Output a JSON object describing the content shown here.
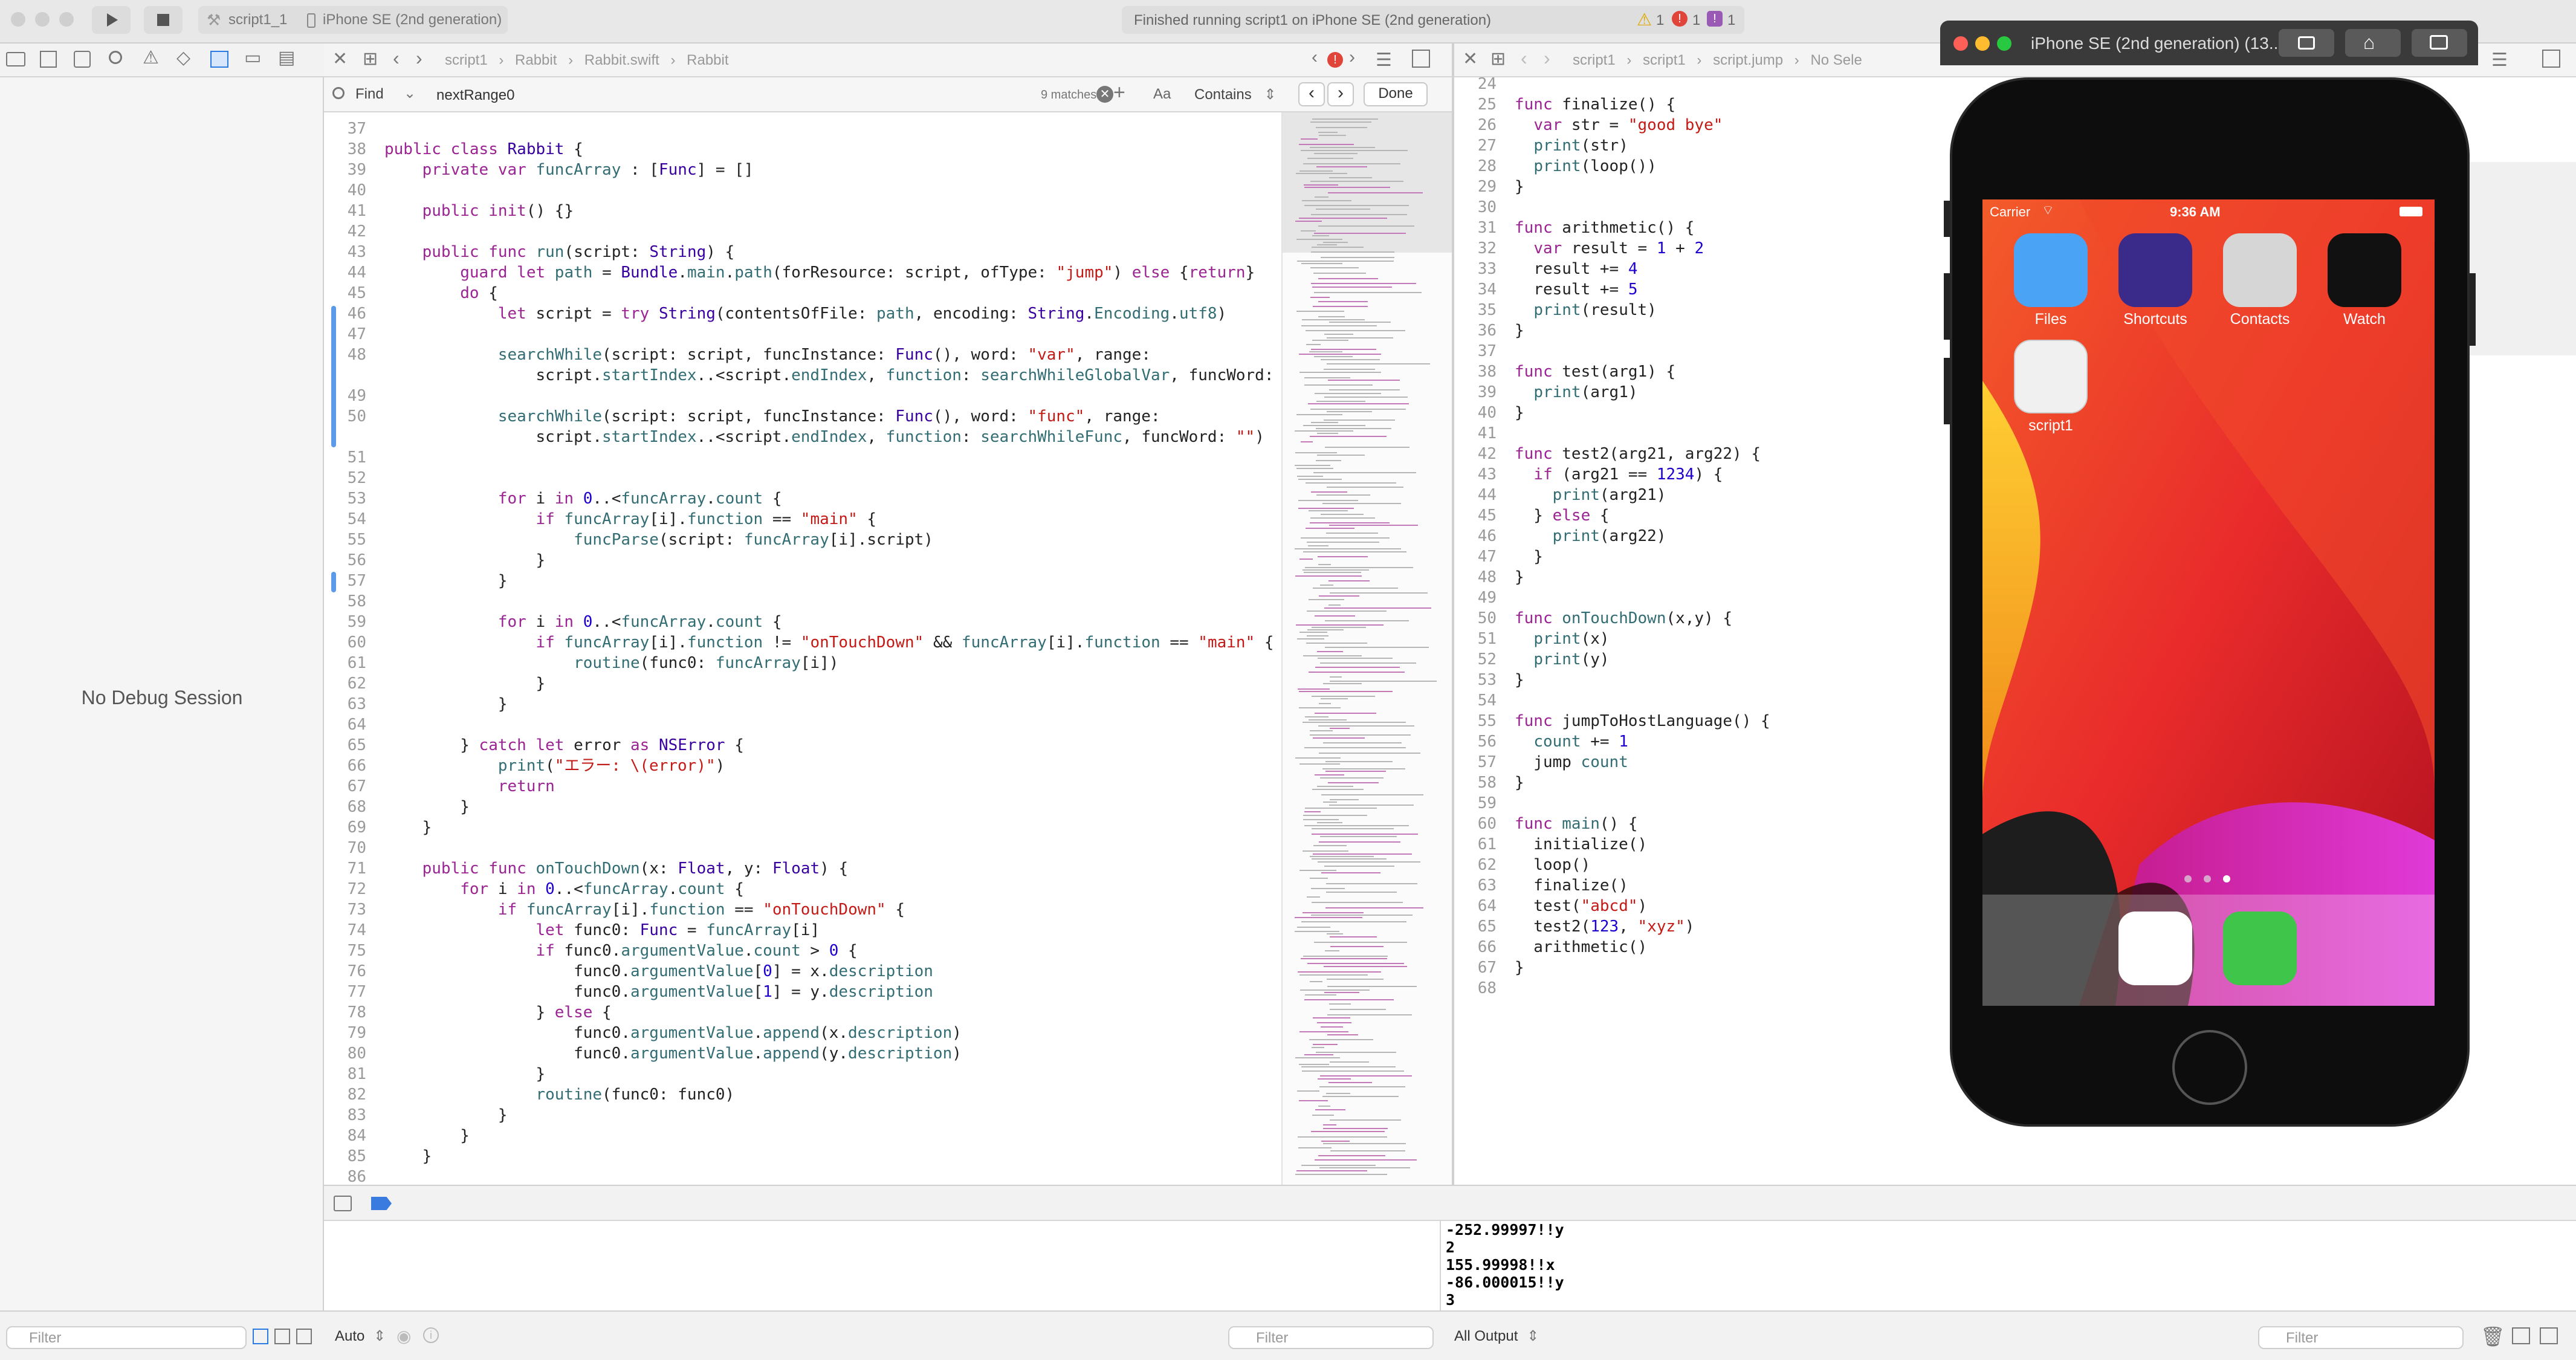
{
  "toolbar": {
    "scheme": "script1_1",
    "device": "iPhone SE (2nd generation)",
    "status": "Finished running script1 on iPhone SE (2nd generation)",
    "warnings": "1",
    "errors": "1",
    "issues": "1"
  },
  "navigator": {
    "no_debug": "No Debug Session",
    "filter_placeholder": "Filter"
  },
  "editor1": {
    "breadcrumbs": [
      "script1",
      "Rabbit",
      "Rabbit.swift",
      "Rabbit"
    ],
    "find_mode": "Find",
    "find_query": "nextRange0",
    "matches": "9 matches",
    "case_label": "Aa",
    "contains_label": "Contains",
    "done_label": "Done",
    "lines": [
      {
        "n": "37",
        "t": ""
      },
      {
        "n": "38",
        "t": "public class Rabbit {"
      },
      {
        "n": "39",
        "t": "    private var funcArray : [Func] = []"
      },
      {
        "n": "40",
        "t": ""
      },
      {
        "n": "41",
        "t": "    public init() {}"
      },
      {
        "n": "42",
        "t": ""
      },
      {
        "n": "43",
        "t": "    public func run(script: String) {"
      },
      {
        "n": "44",
        "t": "        guard let path = Bundle.main.path(forResource: script, ofType: \"jump\") else {return}"
      },
      {
        "n": "45",
        "t": "        do {"
      },
      {
        "n": "46",
        "t": "            let script = try String(contentsOfFile: path, encoding: String.Encoding.utf8)"
      },
      {
        "n": "47",
        "t": ""
      },
      {
        "n": "48",
        "t": "            searchWhile(script: script, funcInstance: Func(), word: \"var\", range:"
      },
      {
        "n": "",
        "t": "                script.startIndex..<script.endIndex, function: searchWhileGlobalVar, funcWord: \"\")"
      },
      {
        "n": "49",
        "t": ""
      },
      {
        "n": "50",
        "t": "            searchWhile(script: script, funcInstance: Func(), word: \"func\", range:"
      },
      {
        "n": "",
        "t": "                script.startIndex..<script.endIndex, function: searchWhileFunc, funcWord: \"\")"
      },
      {
        "n": "51",
        "t": ""
      },
      {
        "n": "52",
        "t": ""
      },
      {
        "n": "53",
        "t": "            for i in 0..<funcArray.count {"
      },
      {
        "n": "54",
        "t": "                if funcArray[i].function == \"main\" {"
      },
      {
        "n": "55",
        "t": "                    funcParse(script: funcArray[i].script)"
      },
      {
        "n": "56",
        "t": "                }"
      },
      {
        "n": "57",
        "t": "            }"
      },
      {
        "n": "58",
        "t": ""
      },
      {
        "n": "59",
        "t": "            for i in 0..<funcArray.count {"
      },
      {
        "n": "60",
        "t": "                if funcArray[i].function != \"onTouchDown\" && funcArray[i].function == \"main\" {"
      },
      {
        "n": "61",
        "t": "                    routine(func0: funcArray[i])"
      },
      {
        "n": "62",
        "t": "                }"
      },
      {
        "n": "63",
        "t": "            }"
      },
      {
        "n": "64",
        "t": ""
      },
      {
        "n": "65",
        "t": "        } catch let error as NSError {"
      },
      {
        "n": "66",
        "t": "            print(\"エラー: \\(error)\")"
      },
      {
        "n": "67",
        "t": "            return"
      },
      {
        "n": "68",
        "t": "        }"
      },
      {
        "n": "69",
        "t": "    }"
      },
      {
        "n": "70",
        "t": ""
      },
      {
        "n": "71",
        "t": "    public func onTouchDown(x: Float, y: Float) {"
      },
      {
        "n": "72",
        "t": "        for i in 0..<funcArray.count {"
      },
      {
        "n": "73",
        "t": "            if funcArray[i].function == \"onTouchDown\" {"
      },
      {
        "n": "74",
        "t": "                let func0: Func = funcArray[i]"
      },
      {
        "n": "75",
        "t": "                if func0.argumentValue.count > 0 {"
      },
      {
        "n": "76",
        "t": "                    func0.argumentValue[0] = x.description"
      },
      {
        "n": "77",
        "t": "                    func0.argumentValue[1] = y.description"
      },
      {
        "n": "78",
        "t": "                } else {"
      },
      {
        "n": "79",
        "t": "                    func0.argumentValue.append(x.description)"
      },
      {
        "n": "80",
        "t": "                    func0.argumentValue.append(y.description)"
      },
      {
        "n": "81",
        "t": "                }"
      },
      {
        "n": "82",
        "t": "                routine(func0: func0)"
      },
      {
        "n": "83",
        "t": "            }"
      },
      {
        "n": "84",
        "t": "        }"
      },
      {
        "n": "85",
        "t": "    }"
      },
      {
        "n": "86",
        "t": ""
      }
    ]
  },
  "editor2": {
    "breadcrumbs": [
      "script1",
      "script1",
      "script.jump",
      "No Sele"
    ],
    "lines": [
      {
        "n": "24",
        "t": ""
      },
      {
        "n": "25",
        "t": "func finalize() {"
      },
      {
        "n": "26",
        "t": "  var str = \"good bye\""
      },
      {
        "n": "27",
        "t": "  print(str)"
      },
      {
        "n": "28",
        "t": "  print(loop())"
      },
      {
        "n": "29",
        "t": "}"
      },
      {
        "n": "30",
        "t": ""
      },
      {
        "n": "31",
        "t": "func arithmetic() {"
      },
      {
        "n": "32",
        "t": "  var result = 1 + 2"
      },
      {
        "n": "33",
        "t": "  result += 4"
      },
      {
        "n": "34",
        "t": "  result += 5"
      },
      {
        "n": "35",
        "t": "  print(result)"
      },
      {
        "n": "36",
        "t": "}"
      },
      {
        "n": "37",
        "t": ""
      },
      {
        "n": "38",
        "t": "func test(arg1) {"
      },
      {
        "n": "39",
        "t": "  print(arg1)"
      },
      {
        "n": "40",
        "t": "}"
      },
      {
        "n": "41",
        "t": ""
      },
      {
        "n": "42",
        "t": "func test2(arg21, arg22) {"
      },
      {
        "n": "43",
        "t": "  if (arg21 == 1234) {"
      },
      {
        "n": "44",
        "t": "    print(arg21)"
      },
      {
        "n": "45",
        "t": "  } else {"
      },
      {
        "n": "46",
        "t": "    print(arg22)"
      },
      {
        "n": "47",
        "t": "  }"
      },
      {
        "n": "48",
        "t": "}"
      },
      {
        "n": "49",
        "t": ""
      },
      {
        "n": "50",
        "t": "func onTouchDown(x,y) {"
      },
      {
        "n": "51",
        "t": "  print(x)"
      },
      {
        "n": "52",
        "t": "  print(y)"
      },
      {
        "n": "53",
        "t": "}"
      },
      {
        "n": "54",
        "t": ""
      },
      {
        "n": "55",
        "t": "func jumpToHostLanguage() {"
      },
      {
        "n": "56",
        "t": "  count += 1"
      },
      {
        "n": "57",
        "t": "  jump count"
      },
      {
        "n": "58",
        "t": "}"
      },
      {
        "n": "59",
        "t": ""
      },
      {
        "n": "60",
        "t": "func main() {"
      },
      {
        "n": "61",
        "t": "  initialize()"
      },
      {
        "n": "62",
        "t": "  loop()"
      },
      {
        "n": "63",
        "t": "  finalize()"
      },
      {
        "n": "64",
        "t": "  test(\"abcd\")"
      },
      {
        "n": "65",
        "t": "  test2(123, \"xyz\")"
      },
      {
        "n": "66",
        "t": "  arithmetic()"
      },
      {
        "n": "67",
        "t": "}"
      },
      {
        "n": "68",
        "t": ""
      }
    ]
  },
  "debug": {
    "console_lines": [
      "-252.99997!!y",
      "2",
      "155.99998!!x",
      "-86.000015!!y",
      "3"
    ],
    "auto_label": "Auto",
    "filter_placeholder": "Filter",
    "output_label": "All Output"
  },
  "simulator": {
    "title": "iPhone SE (2nd generation) (13...",
    "carrier": "Carrier",
    "time": "9:36 AM",
    "apps": [
      {
        "label": "Files",
        "icon": "files-icon",
        "color": "#4aa3f5"
      },
      {
        "label": "Shortcuts",
        "icon": "shortcuts-icon",
        "color": "#3a2a8a"
      },
      {
        "label": "Contacts",
        "icon": "contacts-icon",
        "color": "#d6d6d6"
      },
      {
        "label": "Watch",
        "icon": "watch-icon",
        "color": "#111111"
      },
      {
        "label": "script1",
        "icon": "script1-icon",
        "color": "#f0f0f0"
      }
    ],
    "dock": [
      {
        "icon": "safari-icon",
        "color": "#ffffff"
      },
      {
        "icon": "messages-icon",
        "color": "#3ec54a"
      }
    ]
  }
}
